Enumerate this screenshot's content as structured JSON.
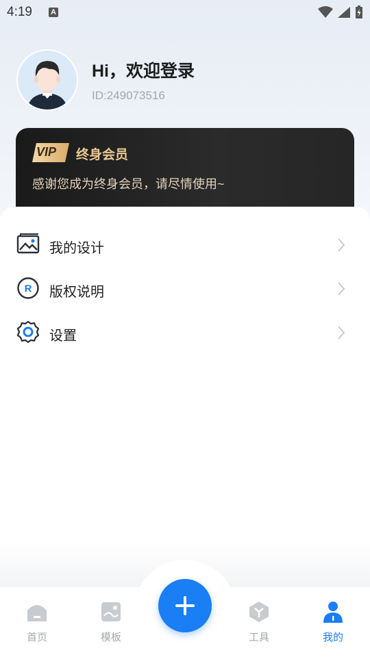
{
  "status_bar": {
    "time": "4:19",
    "notification_icon_letter": "A"
  },
  "profile": {
    "greeting": "Hi，欢迎登录",
    "user_id": "ID:249073516"
  },
  "vip_card": {
    "badge": "VIP",
    "title": "终身会员",
    "description": "感谢您成为终身会员，请尽情使用~"
  },
  "menu": {
    "items": [
      {
        "label": "我的设计",
        "icon": "image-gallery-icon"
      },
      {
        "label": "版权说明",
        "icon": "registered-r-icon"
      },
      {
        "label": "设置",
        "icon": "gear-icon"
      }
    ]
  },
  "tab_bar": {
    "tabs": [
      {
        "label": "首页",
        "icon": "home-icon",
        "active": false
      },
      {
        "label": "模板",
        "icon": "template-icon",
        "active": false
      },
      {
        "label": "工具",
        "icon": "tools-icon",
        "active": false
      },
      {
        "label": "我的",
        "icon": "user-icon",
        "active": true
      }
    ],
    "fab_icon": "plus-icon"
  },
  "colors": {
    "accent": "#1a7ef5",
    "vip_gold": "#e9c892",
    "tab_inactive": "#a6a9ae"
  }
}
